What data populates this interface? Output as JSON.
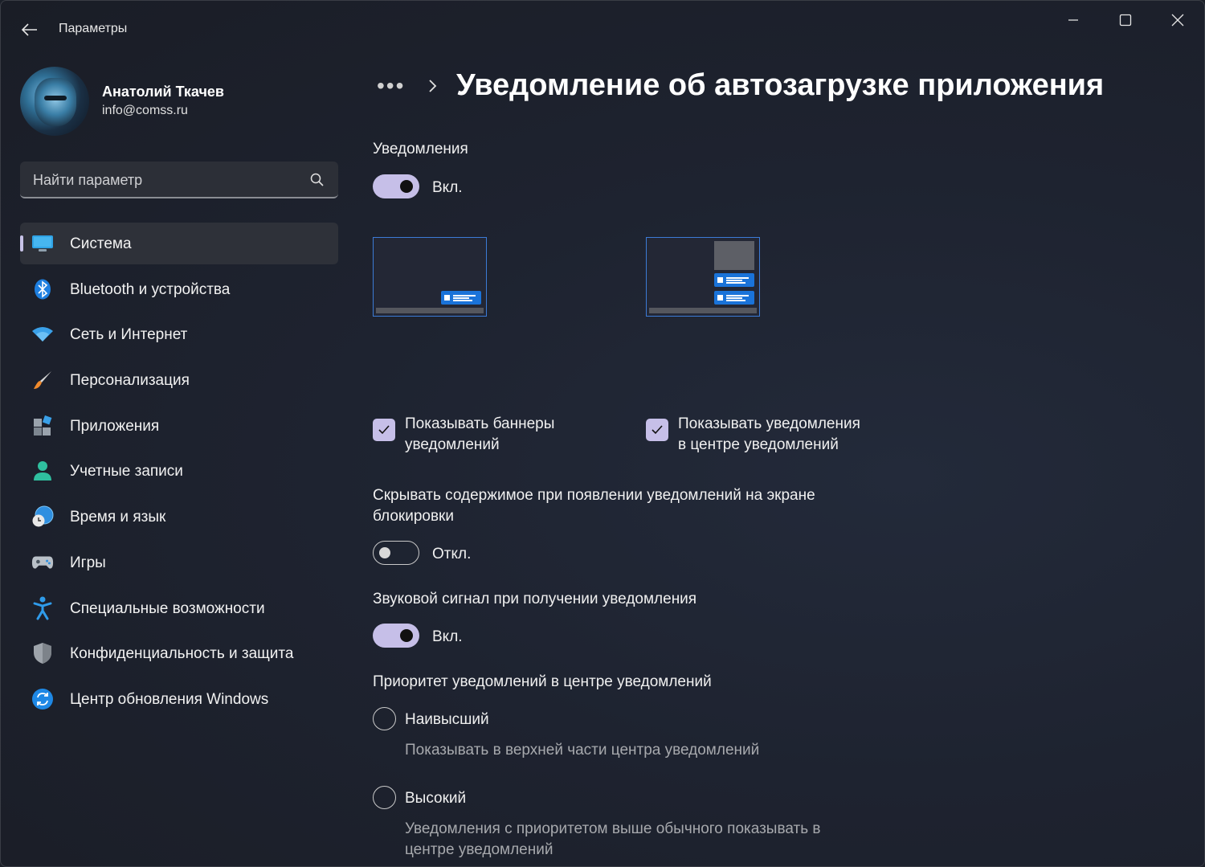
{
  "window": {
    "title": "Параметры"
  },
  "user": {
    "name": "Анатолий Ткачев",
    "email": "info@comss.ru"
  },
  "search": {
    "placeholder": "Найти параметр",
    "icon": "search-icon"
  },
  "nav": {
    "items": [
      {
        "label": "Система",
        "icon": "monitor-icon",
        "active": true
      },
      {
        "label": "Bluetooth и устройства",
        "icon": "bluetooth-icon"
      },
      {
        "label": "Сеть и Интернет",
        "icon": "wifi-icon"
      },
      {
        "label": "Персонализация",
        "icon": "brush-icon"
      },
      {
        "label": "Приложения",
        "icon": "apps-icon"
      },
      {
        "label": "Учетные записи",
        "icon": "person-icon"
      },
      {
        "label": "Время и язык",
        "icon": "globe-clock-icon"
      },
      {
        "label": "Игры",
        "icon": "gamepad-icon"
      },
      {
        "label": "Специальные возможности",
        "icon": "accessibility-icon"
      },
      {
        "label": "Конфиденциальность и защита",
        "icon": "shield-icon"
      },
      {
        "label": "Центр обновления Windows",
        "icon": "update-icon"
      }
    ]
  },
  "breadcrumb": {
    "ellipsis": "•••",
    "title": "Уведомление об автозагрузке приложения"
  },
  "notifications": {
    "label": "Уведомления",
    "state": "Вкл.",
    "on": true
  },
  "options": {
    "banners_label_line1": "Показывать баннеры",
    "banners_label_line2": "уведомлений",
    "banners_checked": true,
    "center_label_line1": "Показывать уведомления",
    "center_label_line2": "в центре уведомлений",
    "center_checked": true
  },
  "lockscreen": {
    "label_line1": "Скрывать содержимое при появлении уведомлений на экране",
    "label_line2": "блокировки",
    "state": "Откл.",
    "on": false
  },
  "sound": {
    "label": "Звуковой сигнал при получении уведомления",
    "state": "Вкл.",
    "on": true
  },
  "priority": {
    "label": "Приоритет уведомлений в центре уведомлений",
    "options": [
      {
        "label": "Наивысший",
        "desc_line1": "Показывать в верхней части центра уведомлений",
        "desc_line2": "",
        "selected": false
      },
      {
        "label": "Высокий",
        "desc_line1": "Уведомления с приоритетом выше обычного показывать в",
        "desc_line2": "центре уведомлений",
        "selected": false
      }
    ]
  },
  "colors": {
    "accent": "#c6bfe8",
    "banner_blue": "#1a73d9",
    "preview_border": "#3c7bd6"
  }
}
